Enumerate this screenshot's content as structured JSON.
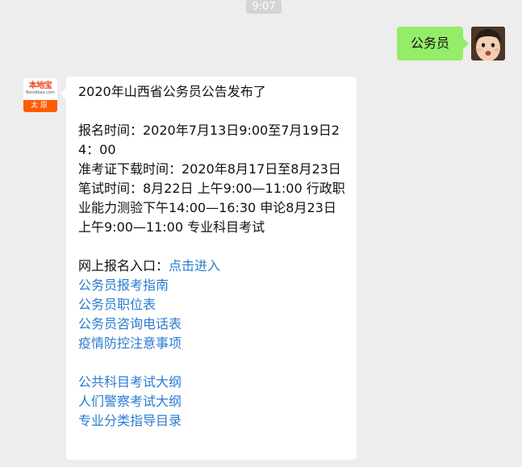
{
  "status": {
    "time": "9:07"
  },
  "user_message": {
    "text": "公务员"
  },
  "bot": {
    "avatar": {
      "brand_name": "本地宝",
      "brand_domain": "Bendibao.com",
      "city": "太原"
    },
    "message": {
      "title": "2020年山西省公务员公告发布了",
      "details": [
        "报名时间：2020年7月13日9:00至7月19日24：00",
        "准考证下载时间：2020年8月17日至8月23日",
        "笔试时间：8月22日 上午9:00—11:00 行政职业能力测验下午14:00—16:30 申论8月23日 上午9:00—11:00 专业科目考试"
      ],
      "signup_prefix": "网上报名入口：",
      "signup_link": "点击进入",
      "links_group_1": [
        "公务员报考指南",
        "公务员职位表",
        "公务员咨询电话表",
        "疫情防控注意事项"
      ],
      "links_group_2": [
        "公共科目考试大纲",
        "人们警察考试大纲",
        "专业分类指导目录"
      ]
    }
  },
  "colors": {
    "background": "#ededed",
    "outgoing_bubble": "#95ec69",
    "incoming_bubble": "#ffffff",
    "link": "#2a7bd0",
    "brand_orange": "#ff5a00"
  }
}
